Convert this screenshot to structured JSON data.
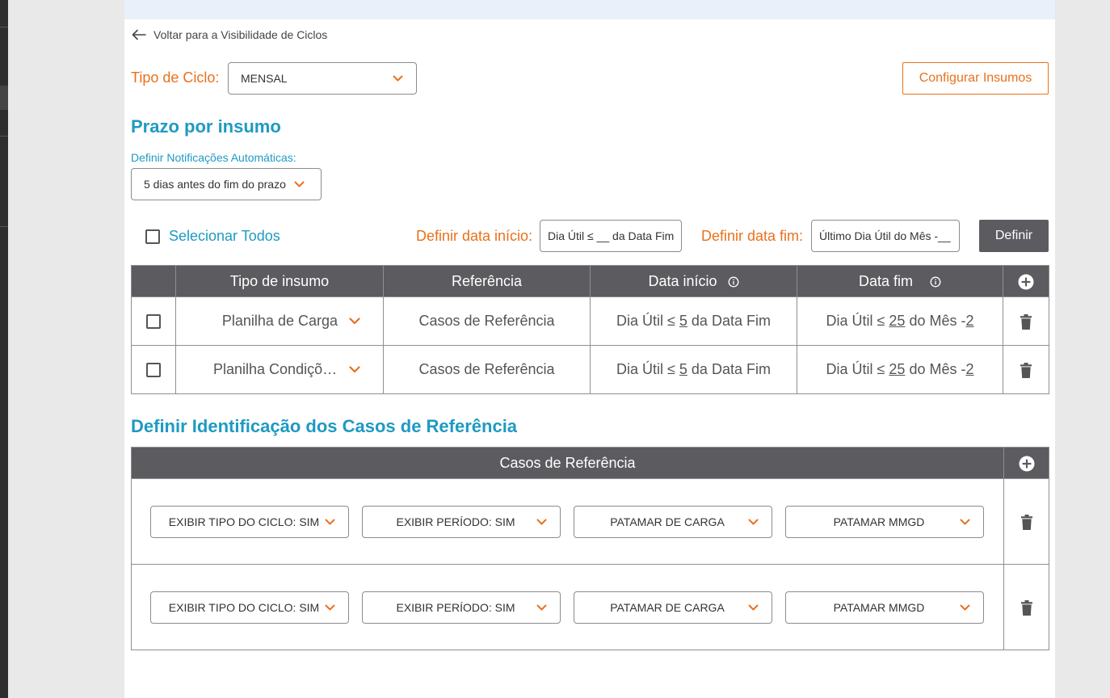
{
  "nav": {
    "back_label": "Voltar para a Visibilidade de Ciclos"
  },
  "cycle": {
    "label": "Tipo de Ciclo:",
    "value": "MENSAL"
  },
  "configure_button": "Configurar Insumos",
  "deadline_section": {
    "title": "Prazo por insumo",
    "notif_label": "Definir Notificações Automáticas:",
    "notif_value": "5 dias antes do fim do prazo"
  },
  "bulk": {
    "select_all_label": "Selecionar Todos",
    "start_label": "Definir data início:",
    "start_value": "Dia Útil ≤ __ da Data Fim",
    "end_label": "Definir data fim:",
    "end_value": "Último Dia Útil do Mês -__",
    "define_button": "Definir"
  },
  "inputs_table": {
    "headers": [
      "Tipo de insumo",
      "Referência",
      "Data início",
      "Data fim"
    ],
    "rows": [
      {
        "tipo": "Planilha de Carga",
        "referencia": "Casos de Referência",
        "inicio": {
          "pre": "Dia Útil ≤ ",
          "num": "5",
          "post": " da Data Fim"
        },
        "fim": {
          "pre": "Dia Útil ≤ ",
          "num": "25",
          "mid": " do Mês -",
          "num2": "2"
        }
      },
      {
        "tipo": "Planilha Condições de Contorno",
        "referencia": "Casos de Referência",
        "inicio": {
          "pre": "Dia Útil ≤ ",
          "num": "5",
          "post": " da Data Fim"
        },
        "fim": {
          "pre": "Dia Útil ≤ ",
          "num": "25",
          "mid": " do Mês -",
          "num2": "2"
        }
      }
    ]
  },
  "reference_section": {
    "title": "Definir Identificação dos Casos de Referência",
    "header": "Casos de Referência",
    "rows": [
      {
        "sel1": "EXIBIR TIPO DO CICLO: SIM",
        "sel2": "EXIBIR PERÍODO: SIM",
        "sel3": "PATAMAR DE CARGA",
        "sel4": "PATAMAR MMGD"
      },
      {
        "sel1": "EXIBIR TIPO DO CICLO: SIM",
        "sel2": "EXIBIR PERÍODO: SIM",
        "sel3": "PATAMAR DE CARGA",
        "sel4": "PATAMAR MMGD"
      }
    ]
  },
  "colors": {
    "accent_orange": "#e8711c",
    "accent_blue": "#1e9ac3",
    "header_gray": "#5c5c60"
  },
  "icons": [
    "arrow-left-icon",
    "chevron-down-icon",
    "info-icon",
    "plus-circle-icon",
    "trash-icon"
  ]
}
